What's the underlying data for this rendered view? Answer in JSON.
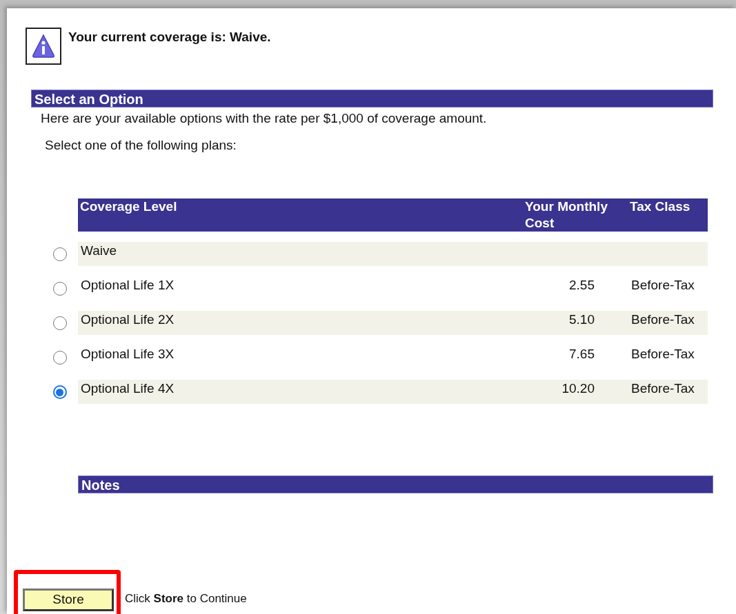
{
  "notice": {
    "message": "Your current coverage is: Waive."
  },
  "options_section": {
    "title": "Select an Option",
    "description": "Here are your available options with the rate per $1,000 of coverage amount.",
    "instruction": "Select one of the following plans:"
  },
  "plans_table": {
    "columns": [
      "Coverage Level",
      "Your Monthly Cost",
      "Tax Class"
    ],
    "rows": [
      {
        "coverage_level": "Waive",
        "selected": false
      },
      {
        "coverage_level": "Optional Life 1X",
        "monthly_cost": "2.55",
        "tax_class": "Before-Tax",
        "selected": false
      },
      {
        "coverage_level": "Optional Life 2X",
        "monthly_cost": "5.10",
        "tax_class": "Before-Tax",
        "selected": false
      },
      {
        "coverage_level": "Optional Life 3X",
        "monthly_cost": "7.65",
        "tax_class": "Before-Tax",
        "selected": false
      },
      {
        "coverage_level": "Optional Life 4X",
        "monthly_cost": "10.20",
        "tax_class": "Before-Tax",
        "selected": true
      }
    ]
  },
  "notes": {
    "title": "Notes"
  },
  "footer": {
    "button": "Store",
    "hint": "Click **Store** to Continue"
  }
}
